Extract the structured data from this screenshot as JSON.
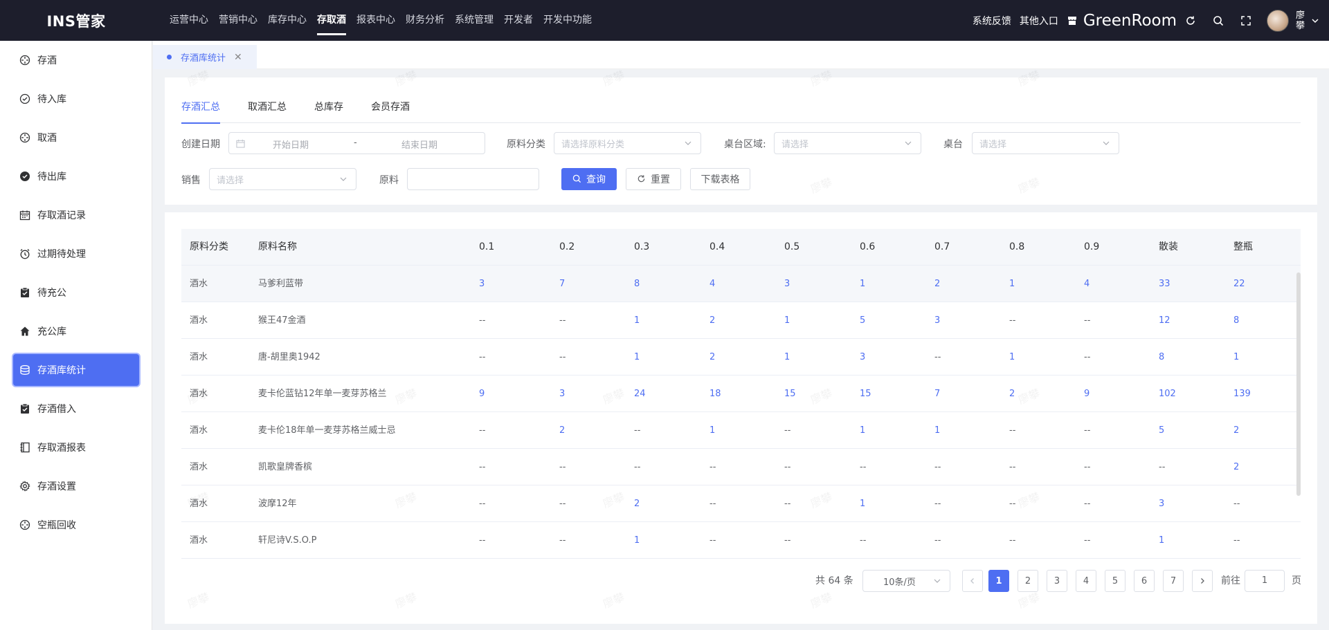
{
  "header": {
    "logo": "INS管家",
    "nav": [
      "运营中心",
      "营销中心",
      "库存中心",
      "存取酒",
      "报表中心",
      "财务分析",
      "系统管理",
      "开发者",
      "开发中功能"
    ],
    "active_nav": "存取酒",
    "feedback": "系统反馈",
    "other_entry": "其他入口",
    "store_name": "GreenRoom",
    "username": "廖攀"
  },
  "sidebar": {
    "items": [
      {
        "label": "存酒",
        "icon": "compass-icon"
      },
      {
        "label": "待入库",
        "icon": "check-circle-icon"
      },
      {
        "label": "取酒",
        "icon": "compass-icon"
      },
      {
        "label": "待出库",
        "icon": "check-circle-filled-icon"
      },
      {
        "label": "存取酒记录",
        "icon": "calendar-icon"
      },
      {
        "label": "过期待处理",
        "icon": "alarm-clock-icon"
      },
      {
        "label": "待充公",
        "icon": "clipboard-check-icon"
      },
      {
        "label": "充公库",
        "icon": "home-icon"
      },
      {
        "label": "存酒库统计",
        "icon": "coins-icon"
      },
      {
        "label": "存酒借入",
        "icon": "clipboard-check-icon"
      },
      {
        "label": "存取酒报表",
        "icon": "notebook-icon"
      },
      {
        "label": "存酒设置",
        "icon": "gear-icon"
      },
      {
        "label": "空瓶回收",
        "icon": "compass-icon"
      }
    ],
    "active": "存酒库统计"
  },
  "page_tab": {
    "label": "存酒库统计"
  },
  "filters": {
    "tabs": [
      "存酒汇总",
      "取酒汇总",
      "总库存",
      "会员存酒"
    ],
    "active_tab": "存酒汇总",
    "create_date_label": "创建日期",
    "start_placeholder": "开始日期",
    "date_separator": "-",
    "end_placeholder": "结束日期",
    "material_category_label": "原料分类",
    "material_category_placeholder": "请选择原料分类",
    "table_area_label": "桌台区域:",
    "table_area_placeholder": "请选择",
    "table_label": "桌台",
    "table_placeholder": "请选择",
    "sales_label": "销售",
    "sales_placeholder": "请选择",
    "material_label": "原料",
    "material_value": "",
    "query_button": "查询",
    "reset_button": "重置",
    "download_button": "下载表格"
  },
  "table": {
    "columns": [
      "原料分类",
      "原料名称",
      "0.1",
      "0.2",
      "0.3",
      "0.4",
      "0.5",
      "0.6",
      "0.7",
      "0.8",
      "0.9",
      "散装",
      "整瓶"
    ],
    "rows": [
      [
        "酒水",
        "马爹利蓝带",
        "3",
        "7",
        "8",
        "4",
        "3",
        "1",
        "2",
        "1",
        "4",
        "33",
        "22"
      ],
      [
        "酒水",
        "猴王47金酒",
        "--",
        "--",
        "1",
        "2",
        "1",
        "5",
        "3",
        "--",
        "--",
        "12",
        "8"
      ],
      [
        "酒水",
        "唐-胡里奥1942",
        "--",
        "--",
        "1",
        "2",
        "1",
        "3",
        "--",
        "1",
        "--",
        "8",
        "1"
      ],
      [
        "酒水",
        "麦卡伦蓝钻12年单一麦芽苏格兰",
        "9",
        "3",
        "24",
        "18",
        "15",
        "15",
        "7",
        "2",
        "9",
        "102",
        "139"
      ],
      [
        "酒水",
        "麦卡伦18年单一麦芽苏格兰威士忌",
        "--",
        "2",
        "--",
        "1",
        "--",
        "1",
        "1",
        "--",
        "--",
        "5",
        "2"
      ],
      [
        "酒水",
        "凯歌皇牌香槟",
        "--",
        "--",
        "--",
        "--",
        "--",
        "--",
        "--",
        "--",
        "--",
        "--",
        "2"
      ],
      [
        "酒水",
        "波摩12年",
        "--",
        "--",
        "2",
        "--",
        "--",
        "1",
        "--",
        "--",
        "--",
        "3",
        "--"
      ],
      [
        "酒水",
        "轩尼诗V.S.O.P",
        "--",
        "--",
        "1",
        "--",
        "--",
        "--",
        "--",
        "--",
        "--",
        "1",
        "--"
      ]
    ]
  },
  "pagination": {
    "total": "共 64 条",
    "page_size": "10条/页",
    "pages": [
      "1",
      "2",
      "3",
      "4",
      "5",
      "6",
      "7"
    ],
    "current": "1",
    "goto_prefix": "前往",
    "goto_value": "1",
    "goto_suffix": "页"
  },
  "watermark": "廖攀",
  "colors": {
    "accent": "#4e6ef2",
    "header_bg": "#1d1e2c"
  }
}
